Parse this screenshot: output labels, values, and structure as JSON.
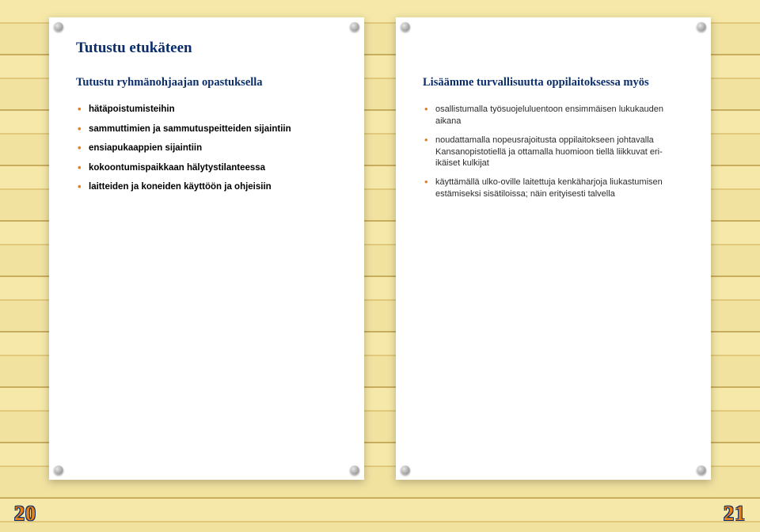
{
  "left_page": {
    "title": "Tutustu etukäteen",
    "subtitle": "Tutustu ryhmänohjaajan opastuksella",
    "items": [
      "hätäpoistumisteihin",
      "sammuttimien ja sammutuspeitteiden sijaintiin",
      "ensiapukaappien sijaintiin",
      "kokoontumispaikkaan hälytystilanteessa",
      "laitteiden ja koneiden käyttöön ja ohjeisiin"
    ],
    "page_number": "20"
  },
  "right_page": {
    "subtitle": "Lisäämme turvallisuutta oppilaitoksessa myös",
    "items": [
      "osallistumalla työsuojeluluentoon ensimmäisen lukukauden aikana",
      "noudattamalla nopeusrajoitusta oppilaitokseen johtavalla Kansanopistotiellä ja ottamalla huomioon tiellä liikkuvat eri-ikäiset kulkijat",
      "käyttämällä ulko-oville laitettuja kenkäharjoja liukastumisen estämiseksi sisätiloissa; näin erityisesti talvella"
    ],
    "page_number": "21"
  }
}
